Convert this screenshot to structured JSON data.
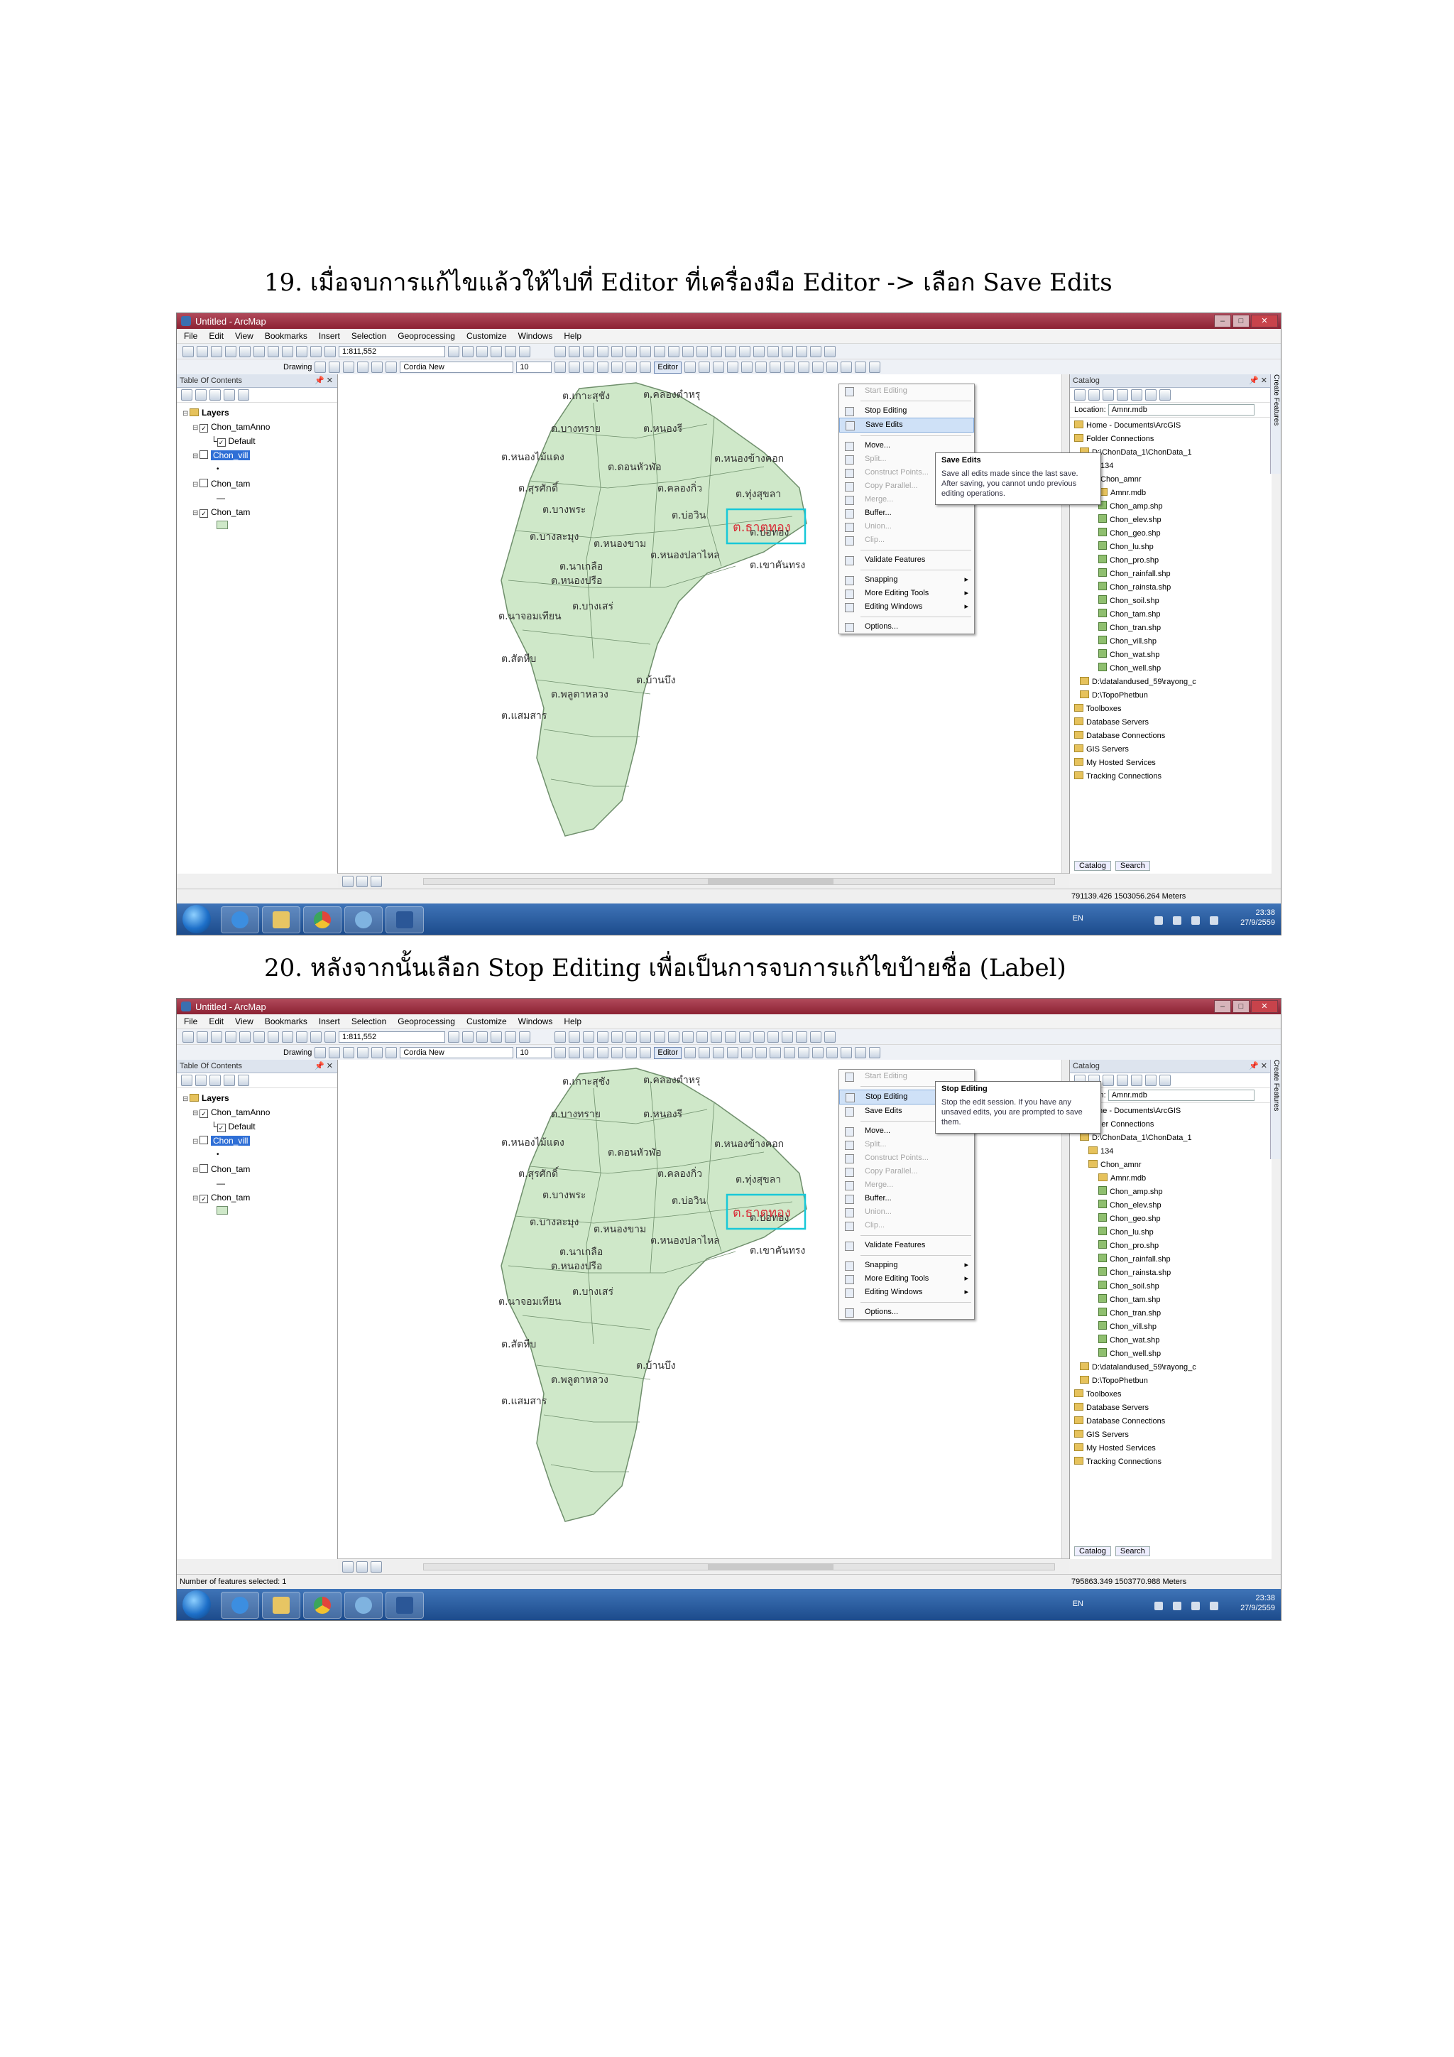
{
  "captions": {
    "step19": "19. เมื่อจบการแก้ไขแล้วให้ไปที่  Editor  ที่เครื่องมือ  Editor  -> เลือก Save Edits",
    "step20": "20. หลังจากนั้นเลือก Stop Editing  เพื่อเป็นการจบการแก้ไขป้ายชื่อ  (Label)"
  },
  "app": {
    "title": "Untitled - ArcMap",
    "menu": [
      "File",
      "Edit",
      "View",
      "Bookmarks",
      "Insert",
      "Selection",
      "Geoprocessing",
      "Customize",
      "Windows",
      "Help"
    ],
    "scale": "1:811,552",
    "drawing_label": "Drawing",
    "font_name": "Cordia New",
    "font_size": "10",
    "editor_button": "Editor"
  },
  "toc": {
    "title": "Table Of Contents",
    "layers_group": "Layers",
    "items": [
      "Chon_tamAnno",
      "Default",
      "Chon_vill",
      "Chon_tam",
      "Chon_tam"
    ]
  },
  "editor_menu": {
    "items": [
      {
        "label": "Start Editing",
        "enabled": false
      },
      {
        "label": "Stop Editing",
        "enabled": true
      },
      {
        "label": "Save Edits",
        "enabled": true
      },
      {
        "label": "Move...",
        "enabled": true
      },
      {
        "label": "Split...",
        "enabled": false
      },
      {
        "label": "Construct Points...",
        "enabled": false
      },
      {
        "label": "Copy Parallel...",
        "enabled": false
      },
      {
        "label": "Merge...",
        "enabled": false
      },
      {
        "label": "Buffer...",
        "enabled": true
      },
      {
        "label": "Union...",
        "enabled": false
      },
      {
        "label": "Clip...",
        "enabled": false
      },
      {
        "label": "Validate Features",
        "enabled": true
      },
      {
        "label": "Snapping",
        "enabled": true,
        "submenu": true
      },
      {
        "label": "More Editing Tools",
        "enabled": true,
        "submenu": true
      },
      {
        "label": "Editing Windows",
        "enabled": true,
        "submenu": true
      },
      {
        "label": "Options...",
        "enabled": true
      }
    ]
  },
  "tooltips": {
    "save": {
      "title": "Save Edits",
      "body": "Save all edits made since the last save. After saving, you cannot undo previous editing operations."
    },
    "stop": {
      "title": "Stop Editing",
      "body": "Stop the edit session. If you have any unsaved edits, you are prompted to save them."
    }
  },
  "catalog": {
    "title": "Catalog",
    "location_label": "Location:",
    "location_value": "Amnr.mdb",
    "tree": [
      "Home - Documents\\ArcGIS",
      "Folder Connections",
      "D:\\ChonData_1\\ChonData_1",
      "134",
      "Chon_amnr",
      "Amnr.mdb",
      "Chon_amp.shp",
      "Chon_elev.shp",
      "Chon_geo.shp",
      "Chon_lu.shp",
      "Chon_pro.shp",
      "Chon_rainfall.shp",
      "Chon_rainsta.shp",
      "Chon_soil.shp",
      "Chon_tam.shp",
      "Chon_tran.shp",
      "Chon_vill.shp",
      "Chon_wat.shp",
      "Chon_well.shp",
      "D:\\datalandused_59\\rayong_c",
      "D:\\TopoPhetbun",
      "Toolboxes",
      "Database Servers",
      "Database Connections",
      "GIS Servers",
      "My Hosted Services",
      "Tracking Connections"
    ],
    "tabs": [
      "Catalog",
      "Search"
    ],
    "side_tab": "Create Features"
  },
  "map_labels": [
    "ต.เกาะสุชัง",
    "ต.คลองตำหรุ",
    "ต.บางทราย",
    "ต.หนองรี",
    "ต.หนองไม้แดง",
    "ต.ดอนหัวฬ่อ",
    "ต.หนองข้างคอก",
    "ต.คลองกิ่ว",
    "ต.สุรศักดิ์",
    "ต.ทุ่งสุขลา",
    "ต.บางพระ",
    "ต.หนองขาม",
    "ต.บ่อวิน",
    "ต.เขาคันทรง",
    "ต.บางละมุง",
    "ต.หนองปลาไหล",
    "ต.นาเกลือ",
    "ต.หนองปรือ",
    "ต.นาจอมเทียน",
    "ต.บางเสร่",
    "ต.สัตหีบ",
    "ต.พลูตาหลวง",
    "ต.แสมสาร",
    "ต.ธาตุทอง",
    "ต.บ่อทอง",
    "ต.บ้านบึง"
  ],
  "shot1": {
    "coords": "791139.426  1503056.264 Meters",
    "status_left": "",
    "tray": {
      "lang": "EN",
      "time": "23:38",
      "date": "27/9/2559"
    }
  },
  "shot2": {
    "coords": "795863.349  1503770.988 Meters",
    "status_left": "Number of features selected: 1",
    "tray": {
      "lang": "EN",
      "time": "23:38",
      "date": "27/9/2559"
    }
  },
  "colors": {
    "land": "#cfe8c9",
    "land_stroke": "#6f8f6c",
    "highlight_box": "#18c8d8",
    "edited_label": "#d8303a",
    "menu_highlight": "#cfe1f7",
    "titlebar": "#9a2d3e"
  }
}
